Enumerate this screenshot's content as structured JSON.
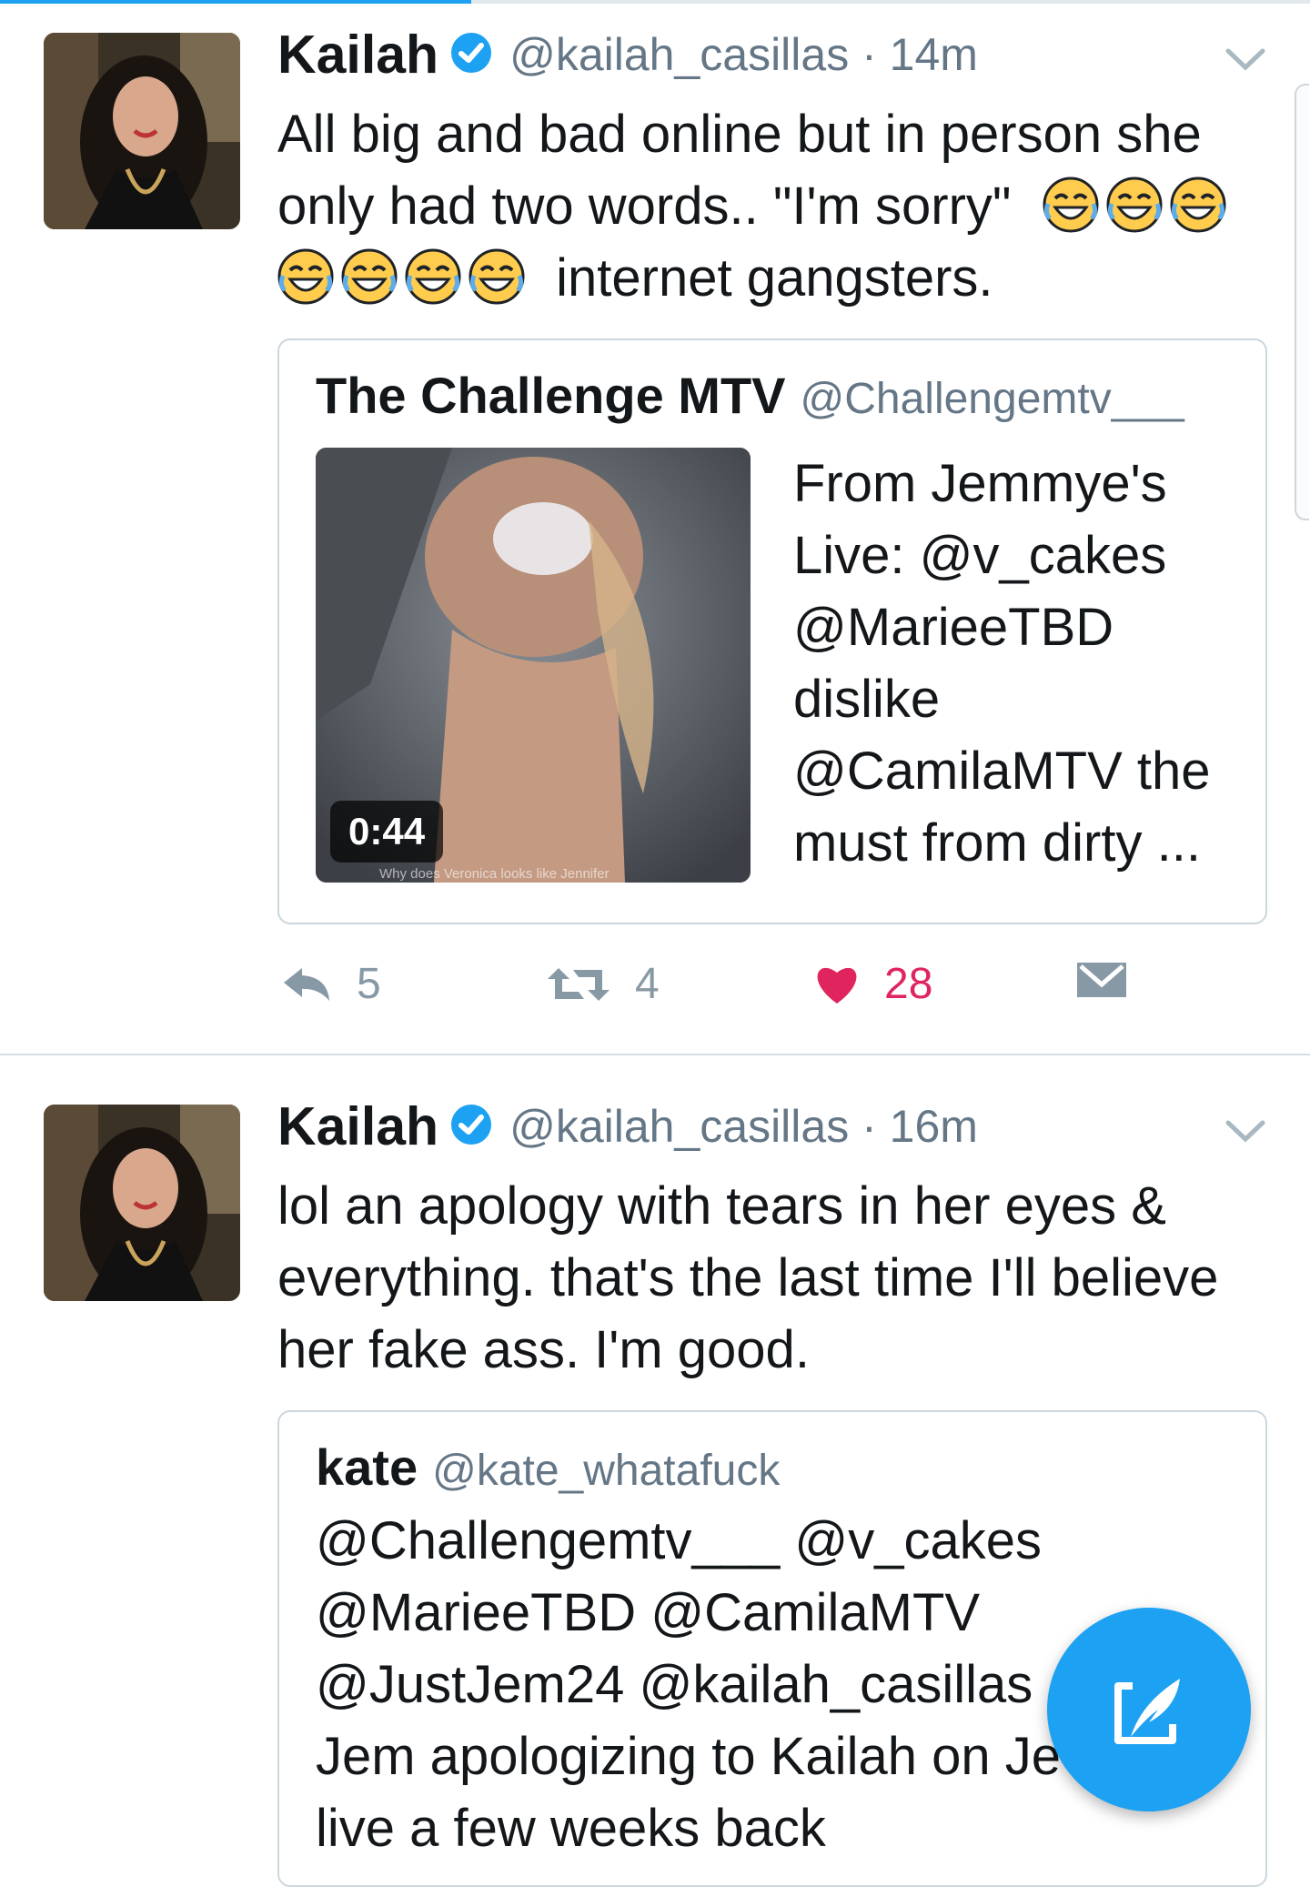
{
  "tweets": [
    {
      "name": "Kailah",
      "handle": "@kailah_casillas",
      "time": "· 14m",
      "text_line1": "All big and bad online but in person she",
      "text_line2": "only had two words.. \"I'm sorry\"",
      "text_line3_end": "internet gangsters.",
      "emoji_name": "face-with-tears-of-joy",
      "quote": {
        "name": "The Challenge MTV",
        "handle": "@Challengemtv___",
        "duration": "0:44",
        "caption": "Why does Veronica looks like Jennifer",
        "text_lines": [
          "From Jemmye's",
          "Live: @v_cakes",
          "@MarieeTBD",
          "dislike",
          "@CamilaMTV the",
          "must from dirty ..."
        ]
      },
      "actions": {
        "replies": "5",
        "retweets": "4",
        "likes": "28"
      }
    },
    {
      "name": "Kailah",
      "handle": "@kailah_casillas",
      "time": "· 16m",
      "text_lines": [
        "lol an apology with tears in her eyes &",
        "everything. that's the last time I'll believe",
        "her fake ass. I'm good."
      ],
      "quote": {
        "name": "kate",
        "handle": "@kate_whatafuck",
        "text_lines": [
          "@Challengemtv___ @v_cakes",
          "@MarieeTBD @CamilaMTV",
          "@JustJem24 @kailah_casillas",
          "Jem apologizing to Kailah on Je",
          "live a few weeks back"
        ]
      }
    }
  ],
  "colors": {
    "accent": "#1da1f2",
    "like": "#e0245e",
    "muted": "#657786"
  },
  "icons": [
    "verified-badge-icon",
    "chevron-down-icon",
    "reply-icon",
    "retweet-icon",
    "heart-icon",
    "direct-message-icon",
    "compose-tweet-icon"
  ]
}
